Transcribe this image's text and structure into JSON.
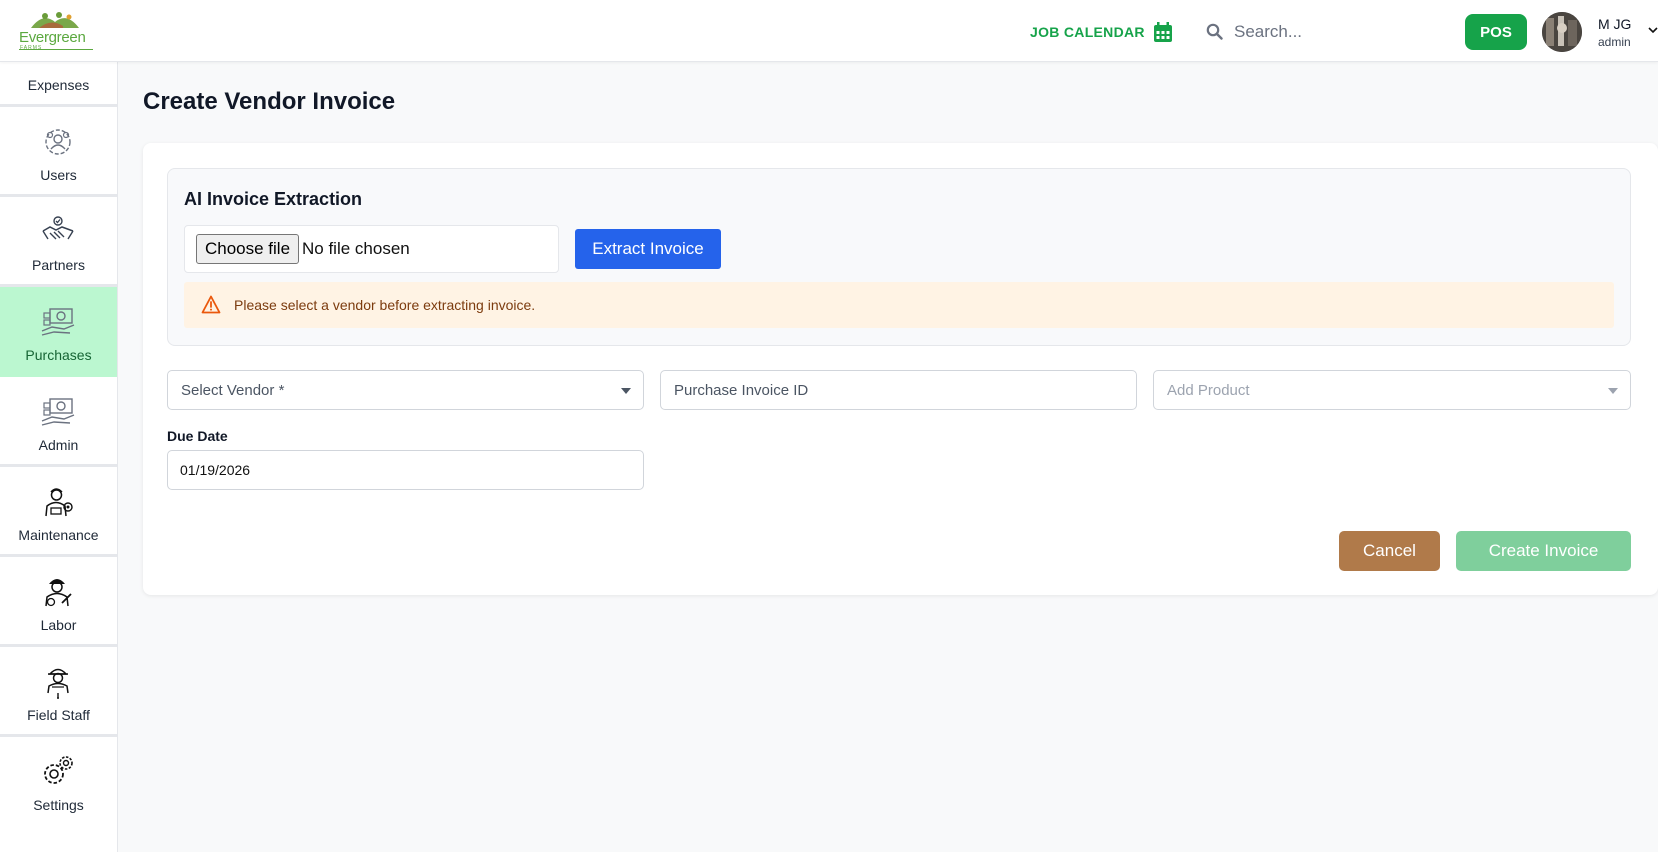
{
  "header": {
    "brand_name": "Evergreen",
    "brand_sub": "FARMS",
    "job_calendar_label": "JOB CALENDAR",
    "search_placeholder": "Search...",
    "pos_label": "POS",
    "user_name": "M JG",
    "user_role": "admin"
  },
  "sidebar": {
    "partial_top_label": "Expenses",
    "items": [
      {
        "label": "Users",
        "icon": "users-gear-icon"
      },
      {
        "label": "Partners",
        "icon": "handshake-icon"
      },
      {
        "label": "Purchases",
        "icon": "purchases-icon",
        "active": true
      },
      {
        "label": "Admin",
        "icon": "admin-icon"
      },
      {
        "label": "Maintenance",
        "icon": "maintenance-worker-icon"
      },
      {
        "label": "Labor",
        "icon": "labor-worker-icon"
      },
      {
        "label": "Field Staff",
        "icon": "field-staff-icon"
      },
      {
        "label": "Settings",
        "icon": "gear-icon"
      }
    ]
  },
  "main": {
    "page_title": "Create Vendor Invoice",
    "ai_section": {
      "title": "AI Invoice Extraction",
      "choose_file_label": "Choose file",
      "file_status": "No file chosen",
      "extract_label": "Extract Invoice",
      "warning": "Please select a vendor before extracting invoice."
    },
    "form": {
      "vendor_placeholder": "Select Vendor *",
      "purchase_invoice_placeholder": "Purchase Invoice ID",
      "add_product_placeholder": "Add Product",
      "due_date_label": "Due Date",
      "due_date_value": "01/19/2026"
    },
    "actions": {
      "cancel_label": "Cancel",
      "create_label": "Create Invoice"
    }
  },
  "colors": {
    "brand_green": "#16a34a",
    "active_sidebar_bg": "#bbf7d0",
    "extract_blue": "#2563eb",
    "cancel_brown": "#b07a4a",
    "create_disabled_green": "#7fcf9c",
    "warning_bg": "#fff3e4",
    "warning_icon": "#ea580c"
  }
}
